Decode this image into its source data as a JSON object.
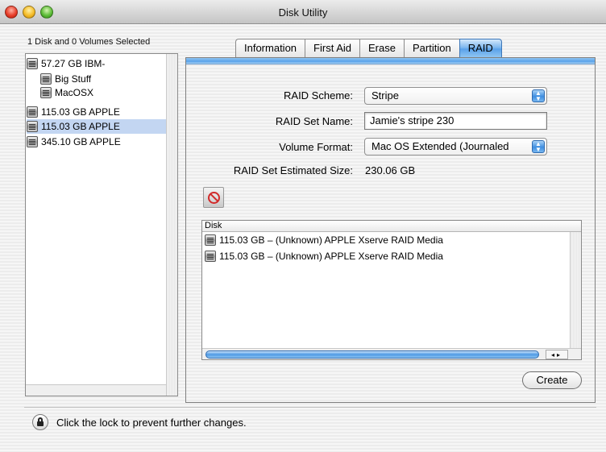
{
  "window": {
    "title": "Disk Utility"
  },
  "left_pane": {
    "header": "1 Disk and 0 Volumes Selected",
    "items": [
      {
        "label": "57.27 GB IBM-",
        "selected": false
      },
      {
        "label": "Big Stuff",
        "selected": false
      },
      {
        "label": "MacOSX",
        "selected": false
      },
      {
        "label": "115.03 GB APPLE",
        "selected": false
      },
      {
        "label": "115.03 GB APPLE",
        "selected": true
      },
      {
        "label": "345.10 GB APPLE",
        "selected": false
      }
    ]
  },
  "tabs": [
    {
      "label": "Information",
      "active": false
    },
    {
      "label": "First Aid",
      "active": false
    },
    {
      "label": "Erase",
      "active": false
    },
    {
      "label": "Partition",
      "active": false
    },
    {
      "label": "RAID",
      "active": true
    }
  ],
  "raid": {
    "scheme_label": "RAID Scheme:",
    "scheme_value": "Stripe",
    "name_label": "RAID Set Name:",
    "name_value": "Jamie's stripe 230",
    "format_label": "Volume Format:",
    "format_value": "Mac OS Extended (Journaled",
    "size_label": "RAID Set Estimated Size:",
    "size_value": "230.06 GB"
  },
  "member_table": {
    "column": "Disk",
    "rows": [
      "115.03 GB – (Unknown) APPLE Xserve RAID Media",
      "115.03 GB – (Unknown) APPLE Xserve RAID Media"
    ]
  },
  "buttons": {
    "create": "Create"
  },
  "lock": {
    "text": "Click the lock to prevent further changes."
  },
  "colors": {
    "accent": "#5aa2ea",
    "selection": "#c3d6f2"
  }
}
